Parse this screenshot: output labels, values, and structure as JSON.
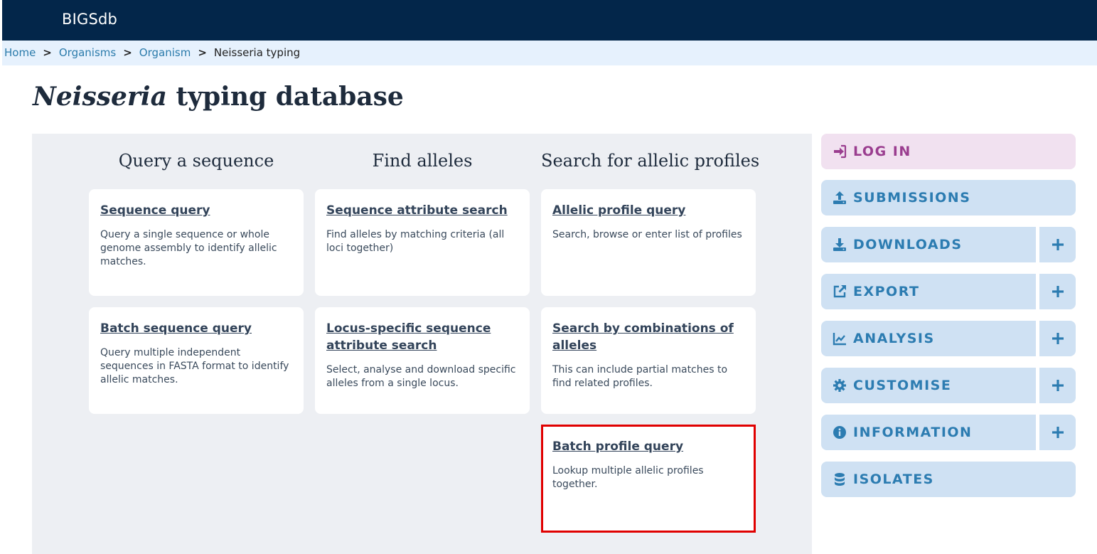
{
  "app": {
    "brand": "BIGSdb"
  },
  "breadcrumb": {
    "items": [
      "Home",
      "Organisms",
      "Organism"
    ],
    "current": "Neisseria typing"
  },
  "page": {
    "title_italic": "Neisseria",
    "title_rest": " typing database"
  },
  "columns": {
    "query_sequence": {
      "heading": "Query a sequence",
      "cards": [
        {
          "title": "Sequence query",
          "desc": "Query a single sequence or whole genome assembly to identify allelic matches."
        },
        {
          "title": "Batch sequence query",
          "desc": "Query multiple independent sequences in FASTA format to identify allelic matches."
        }
      ]
    },
    "find_alleles": {
      "heading": "Find alleles",
      "cards": [
        {
          "title": "Sequence attribute search",
          "desc": "Find alleles by matching criteria (all loci together)"
        },
        {
          "title": "Locus-specific sequence attribute search",
          "desc": "Select, analyse and download specific alleles from a single locus."
        }
      ]
    },
    "allelic_profiles": {
      "heading": "Search for allelic profiles",
      "cards": [
        {
          "title": "Allelic profile query",
          "desc": "Search, browse or enter list of profiles"
        },
        {
          "title": "Search by combinations of alleles",
          "desc": "This can include partial matches to find related profiles."
        },
        {
          "title": "Batch profile query",
          "desc": "Lookup multiple allelic profiles together."
        }
      ]
    }
  },
  "sidebar": {
    "login": "LOG IN",
    "submissions": "SUBMISSIONS",
    "downloads": "DOWNLOADS",
    "export": "EXPORT",
    "analysis": "ANALYSIS",
    "customise": "CUSTOMISE",
    "information": "INFORMATION",
    "isolates": "ISOLATES"
  },
  "colors": {
    "topbar": "#03264a",
    "breadcrumb_bg": "#e6f1fd",
    "menu_bg": "#cfe1f3",
    "menu_text": "#2c7cb1",
    "login_bg": "#f1e1f0",
    "login_text": "#9a3d8f",
    "highlight_border": "#e00000"
  },
  "icons": {
    "login": "sign-in-icon",
    "submissions": "upload-icon",
    "downloads": "download-icon",
    "export": "external-link-icon",
    "analysis": "chart-line-icon",
    "customise": "gear-icon",
    "information": "info-circle-icon",
    "isolates": "database-icon",
    "expand": "plus-icon"
  }
}
